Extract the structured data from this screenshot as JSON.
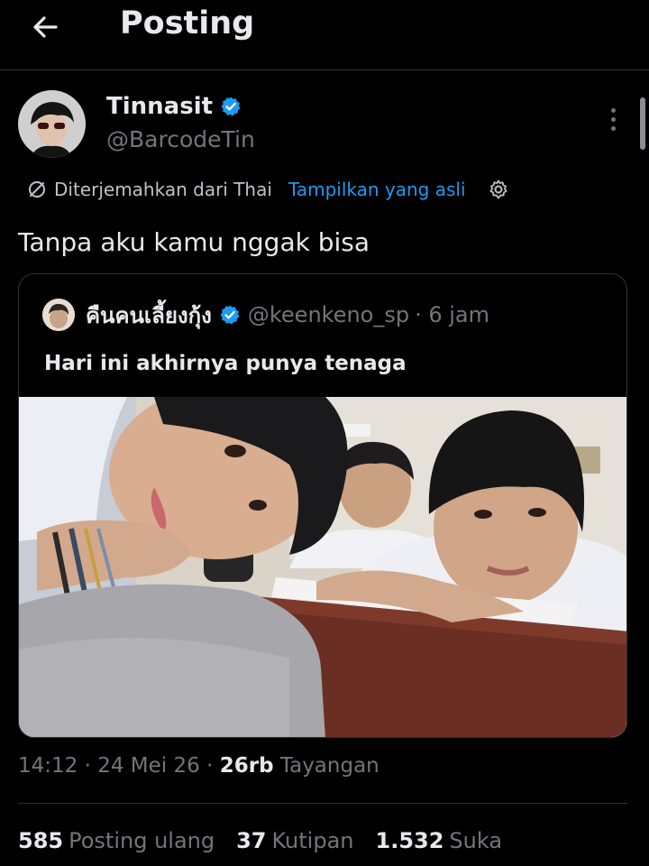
{
  "header": {
    "title": "Posting"
  },
  "author": {
    "name": "Tinnasit",
    "handle": "@BarcodeTin",
    "verified": true
  },
  "translation": {
    "notice": "Diterjemahkan dari Thai",
    "show_original": "Tampilkan yang asli"
  },
  "post": {
    "text": "Tanpa aku kamu nggak bisa"
  },
  "quote": {
    "name": "คืนคนเลี้ยงกุ้ง",
    "handle": "@keenkeno_sp",
    "time": "· 6 jam",
    "text": "Hari ini akhirnya punya tenaga"
  },
  "meta": {
    "time": "14:12",
    "date": "· 24 Mei 26 ·",
    "views_count": "26rb",
    "views_label": "Tayangan"
  },
  "stats": [
    {
      "count": "585",
      "label": "Posting ulang"
    },
    {
      "count": "37",
      "label": "Kutipan"
    },
    {
      "count": "1.532",
      "label": "Suka"
    }
  ],
  "colors": {
    "accent": "#1d9bf0",
    "background": "#000000",
    "muted": "#71767b",
    "text": "#e7e9ea"
  },
  "icons": [
    "back-arrow-icon",
    "verified-badge-icon",
    "translate-icon",
    "settings-icon",
    "more-vertical-icon"
  ]
}
